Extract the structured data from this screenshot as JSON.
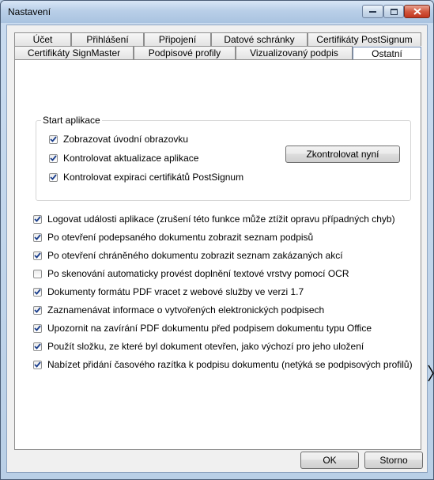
{
  "window": {
    "title": "Nastavení"
  },
  "tabs_row1": [
    {
      "label": "Účet"
    },
    {
      "label": "Přihlášení"
    },
    {
      "label": "Připojení"
    },
    {
      "label": "Datové schránky"
    },
    {
      "label": "Certifikáty PostSignum"
    }
  ],
  "tabs_row2": [
    {
      "label": "Certifikáty SignMaster"
    },
    {
      "label": "Podpisové profily"
    },
    {
      "label": "Vizualizovaný podpis"
    },
    {
      "label": "Ostatní",
      "active": true
    }
  ],
  "startup": {
    "title": "Start aplikace",
    "items": [
      {
        "label": "Zobrazovat úvodní obrazovku",
        "checked": true
      },
      {
        "label": "Kontrolovat aktualizace aplikace",
        "checked": true
      },
      {
        "label": "Kontrolovat expiraci certifikátů PostSignum",
        "checked": true
      }
    ],
    "check_now_label": "Zkontrolovat nyní"
  },
  "options": [
    {
      "label": "Logovat události aplikace (zrušení této funkce může ztížit opravu případných chyb)",
      "checked": true
    },
    {
      "label": "Po otevření podepsaného dokumentu zobrazit seznam podpisů",
      "checked": true
    },
    {
      "label": "Po otevření chráněného dokumentu zobrazit seznam zakázaných akcí",
      "checked": true
    },
    {
      "label": "Po skenování automaticky provést doplnění textové vrstvy pomocí OCR",
      "checked": false
    },
    {
      "label": "Dokumenty formátu PDF vracet z webové služby ve verzi 1.7",
      "checked": true
    },
    {
      "label": "Zaznamenávat informace o vytvořených elektronických podpisech",
      "checked": true
    },
    {
      "label": "Upozornit na zavírání PDF dokumentu před podpisem dokumentu typu Office",
      "checked": true
    },
    {
      "label": "Použít složku, ze které byl dokument otevřen, jako výchozí pro jeho uložení",
      "checked": true
    },
    {
      "label": "Nabízet přidání časového razítka k podpisu dokumentu (netýká se podpisových profilů)",
      "checked": true
    }
  ],
  "footer": {
    "ok_label": "OK",
    "cancel_label": "Storno"
  }
}
